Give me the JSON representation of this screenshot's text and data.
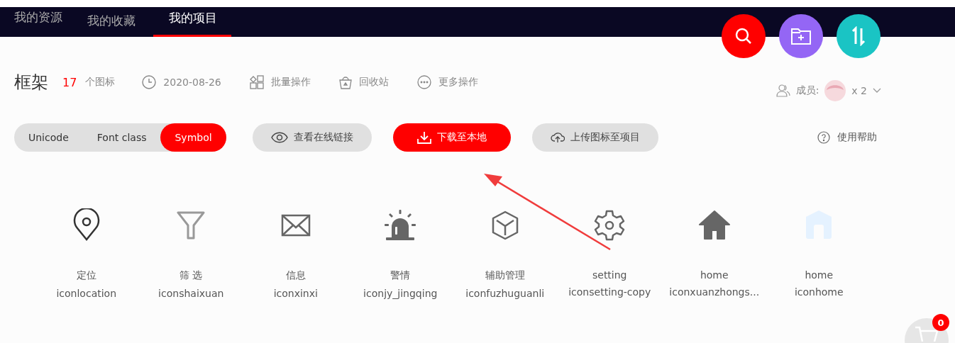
{
  "nav": {
    "tabs": [
      {
        "label": "我的资源",
        "selected": false
      },
      {
        "label": "我的收藏",
        "selected": false
      },
      {
        "label": "我的项目",
        "selected": true
      }
    ]
  },
  "fab_buttons": [
    {
      "kind": "search",
      "color": "#ff0000"
    },
    {
      "kind": "folder-add",
      "color": "#9466f5"
    },
    {
      "kind": "sort",
      "color": "#1ac4c4"
    }
  ],
  "project": {
    "title": "框架",
    "count": "17",
    "count_label": "个图标",
    "date": "2020-08-26",
    "actions": [
      {
        "kind": "batch",
        "label": "批量操作"
      },
      {
        "kind": "trash",
        "label": "回收站"
      },
      {
        "kind": "more",
        "label": "更多操作"
      }
    ],
    "members_label": "成员:",
    "members_count": "x 2"
  },
  "format_tabs": [
    {
      "label": "Unicode",
      "selected": false
    },
    {
      "label": "Font class",
      "selected": false
    },
    {
      "label": "Symbol",
      "selected": true
    }
  ],
  "buttons": [
    {
      "kind": "view",
      "label": "查看在线链接",
      "primary": false
    },
    {
      "kind": "download",
      "label": "下载至本地",
      "primary": true
    },
    {
      "kind": "upload",
      "label": "上传图标至项目",
      "primary": false
    }
  ],
  "help": "使用帮助",
  "icons": [
    {
      "kind": "location",
      "color": "#333333",
      "name": "定位",
      "code": "iconlocation"
    },
    {
      "kind": "filter",
      "color": "#999999",
      "name": "筛 选",
      "code": "iconshaixuan"
    },
    {
      "kind": "mail",
      "color": "#666666",
      "name": "信息",
      "code": "iconxinxi"
    },
    {
      "kind": "alarm",
      "color": "#666666",
      "name": "警情",
      "code": "iconjy_jingqing"
    },
    {
      "kind": "cube",
      "color": "#666666",
      "name": "辅助管理",
      "code": "iconfuzhuguanli"
    },
    {
      "kind": "gear",
      "color": "#666666",
      "name": "setting",
      "code": "iconsetting-copy"
    },
    {
      "kind": "house",
      "color": "#666666",
      "name": "home",
      "code": "iconxuanzhongs..."
    },
    {
      "kind": "house2",
      "color": "#e5f2ff",
      "name": "home",
      "code": "iconhome"
    }
  ],
  "cart": {
    "badge": "0"
  }
}
